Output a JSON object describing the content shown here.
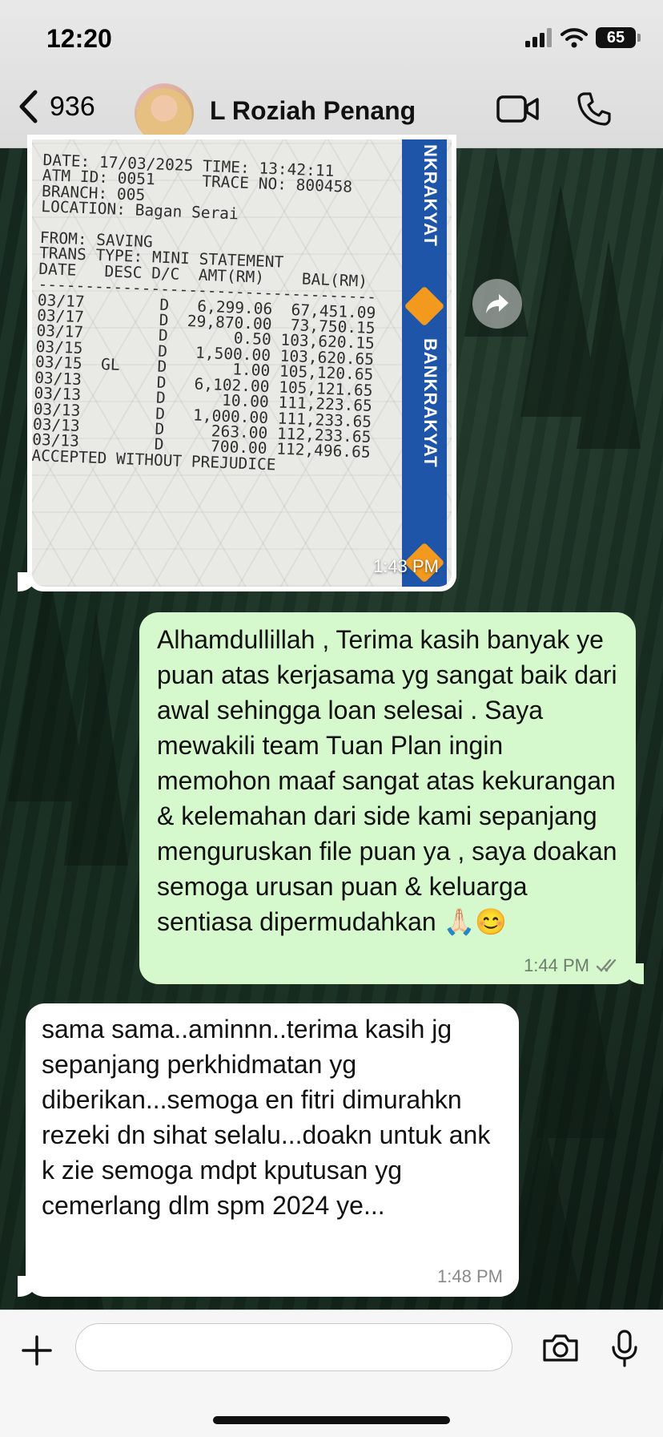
{
  "status_bar": {
    "time": "12:20",
    "battery": "65"
  },
  "header": {
    "back_count": "936",
    "contact_name": "L Roziah Penang"
  },
  "messages": {
    "image_message": {
      "time": "1:43 PM",
      "receipt_lines": [
        "DATE: 17/03/2025 TIME: 13:42:11",
        "ATM ID: 0051     TRACE NO: 800458",
        "BRANCH: 005",
        "LOCATION: Bagan Serai",
        "",
        "FROM: SAVING",
        "TRANS TYPE: MINI STATEMENT",
        "DATE   DESC D/C  AMT(RM)    BAL(RM)",
        "------------------------------------",
        "03/17        D   6,299.06  67,451.09",
        "03/17        D  29,870.00  73,750.15",
        "03/17        D       0.50 103,620.15",
        "03/15        D   1,500.00 103,620.65",
        "03/15  GL    D       1.00 105,120.65",
        "03/13        D   6,102.00 105,121.65",
        "03/13        D      10.00 111,223.65",
        "03/13        D   1,000.00 111,233.65",
        "03/13        D     263.00 112,233.65",
        "03/13        D     700.00 112,496.65",
        "ACCEPTED WITHOUT PREJUDICE"
      ],
      "bank_labels": [
        "NKRAKYAT",
        "BANKRAKYAT"
      ]
    },
    "outgoing": {
      "text": "Alhamdullillah , Terima kasih banyak ye puan atas kerjasama yg sangat baik dari awal sehingga loan selesai . Saya mewakili team Tuan Plan ingin memohon maaf sangat atas kekurangan & kelemahan dari side kami sepanjang menguruskan file puan ya , saya doakan semoga urusan puan & keluarga sentiasa dipermudahkan 🙏🏻😊",
      "time": "1:44 PM"
    },
    "incoming": {
      "text": "sama sama..aminnn..terima kasih jg sepanjang perkhidmatan yg diberikan...semoga en fitri dimurahkn rezeki dn sihat selalu...doakn untuk ank k zie semoga mdpt kputusan yg cemerlang dlm spm 2024 ye...",
      "time": "1:48 PM"
    }
  },
  "composer": {
    "input_value": ""
  },
  "icons": {
    "back": "chevron-left-icon",
    "video": "video-camera-icon",
    "call": "phone-icon",
    "forward": "forward-arrow-icon",
    "plus": "plus-icon",
    "sticker": "sticker-icon",
    "camera": "camera-icon",
    "mic": "microphone-icon",
    "read": "double-check-icon"
  },
  "colors": {
    "outgoing_bubble": "#d5f8cd",
    "incoming_bubble": "#ffffff",
    "bank_blue": "#1f55a8",
    "bank_orange": "#f39a1e"
  }
}
